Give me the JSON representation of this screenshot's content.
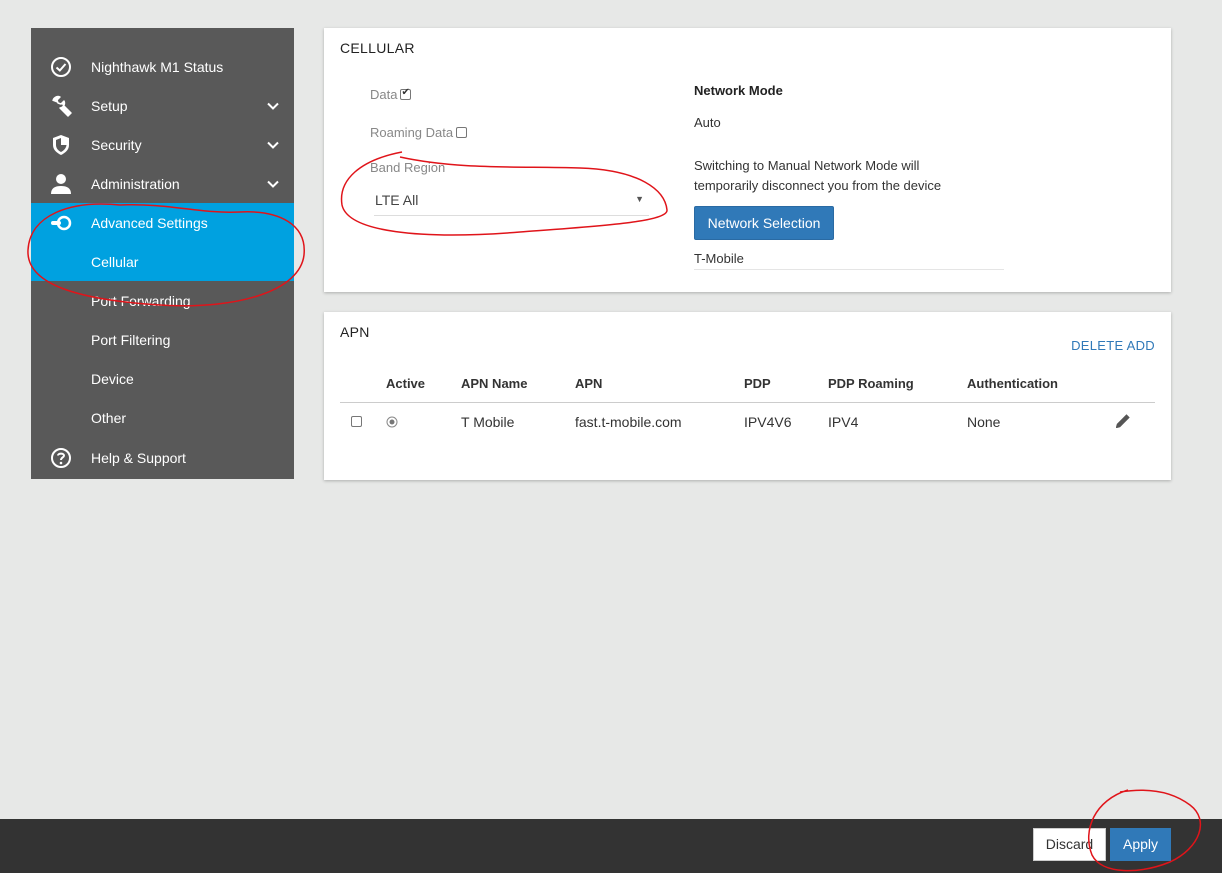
{
  "sidebar": {
    "items": [
      {
        "label": "Nighthawk M1 Status",
        "icon": "check-circle-icon"
      },
      {
        "label": "Setup",
        "icon": "wrench-icon"
      },
      {
        "label": "Security",
        "icon": "shield-icon"
      },
      {
        "label": "Administration",
        "icon": "user-icon"
      },
      {
        "label": "Advanced Settings",
        "icon": "toggle-icon"
      },
      {
        "label": "Cellular"
      },
      {
        "label": "Port Forwarding"
      },
      {
        "label": "Port Filtering"
      },
      {
        "label": "Device"
      },
      {
        "label": "Other"
      },
      {
        "label": "Help & Support",
        "icon": "help-icon"
      }
    ],
    "active_color": "#00a1e0"
  },
  "cellular": {
    "title": "CELLULAR",
    "data_label": "Data",
    "data_checked": true,
    "roaming_label": "Roaming Data",
    "roaming_checked": false,
    "band_region_label": "Band Region",
    "band_region_value": "LTE All",
    "network_mode_label": "Network Mode",
    "network_mode_value": "Auto",
    "switch_note_line1": "Switching to Manual Network Mode will",
    "switch_note_line2": "temporarily disconnect you from the device",
    "network_selection_button": "Network Selection",
    "network_operator": "T-Mobile"
  },
  "apn": {
    "title": "APN",
    "delete_label": "DELETE",
    "add_label": "ADD",
    "columns": [
      "Active",
      "APN Name",
      "APN",
      "PDP",
      "PDP Roaming",
      "Authentication"
    ],
    "rows": [
      {
        "selected": false,
        "active": true,
        "name": "T Mobile",
        "apn": "fast.t-mobile.com",
        "pdp": "IPV4V6",
        "pdp_roaming": "IPV4",
        "auth": "None"
      }
    ]
  },
  "footer": {
    "discard_label": "Discard",
    "apply_label": "Apply"
  },
  "colors": {
    "primary": "#3079b8",
    "annotation": "#e0141a"
  }
}
